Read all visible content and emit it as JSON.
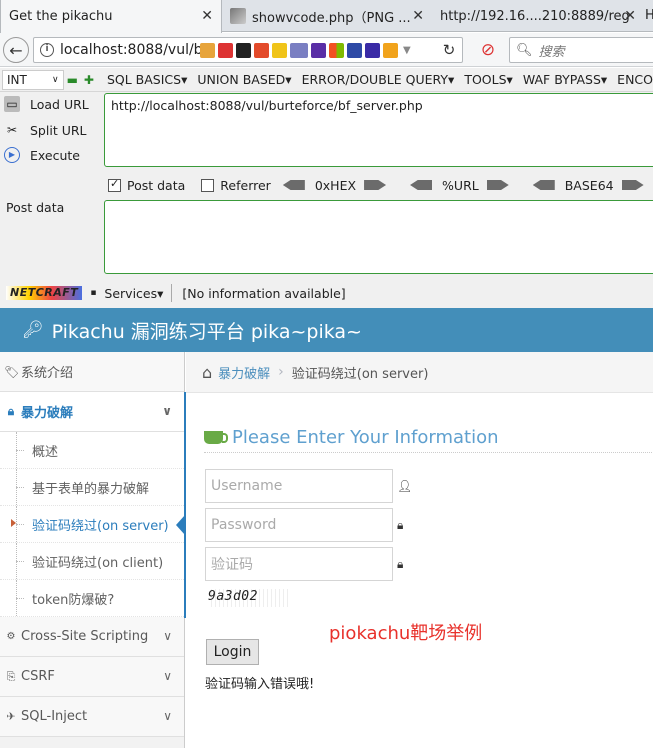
{
  "browser": {
    "tabs": [
      {
        "title": "Get the pikachu",
        "active": true
      },
      {
        "title": "showvcode.php（PNG ...",
        "active": false
      },
      {
        "title": "http://192.16....210:8889/reg",
        "active": false
      }
    ],
    "url": "localhost:8088/vul/b",
    "search_placeholder": "搜索"
  },
  "hackbar": {
    "select_value": "INT",
    "menus": [
      "SQL BASICS▾",
      "UNION BASED▾",
      "ERROR/DOUBLE QUERY▾",
      "TOOLS▾",
      "WAF BYPASS▾",
      "ENCO"
    ],
    "actions": {
      "load_url": "Load URL",
      "split_url": "Split URL",
      "execute": "Execute"
    },
    "url_value": "http://localhost:8088/vul/burteforce/bf_server.php",
    "post_data_checkbox": "Post data",
    "referrer_checkbox": "Referrer",
    "encoders": [
      "0xHEX",
      "%URL",
      "BASE64"
    ],
    "post_data_label": "Post data",
    "netcraft": {
      "logo": "NETCRAFT",
      "services": "Services▾",
      "info": "[No information available]"
    }
  },
  "site": {
    "header_title": "Pikachu 漏洞练习平台 pika~pika~",
    "sidebar": {
      "items": [
        {
          "label": "系统介绍",
          "open": false
        },
        {
          "label": "暴力破解",
          "open": true,
          "children": [
            "概述",
            "基于表单的暴力破解",
            "验证码绕过(on server)",
            "验证码绕过(on client)",
            "token防爆破?"
          ]
        },
        {
          "label": "Cross-Site Scripting",
          "open": false
        },
        {
          "label": "CSRF",
          "open": false
        },
        {
          "label": "SQL-Inject",
          "open": false
        }
      ]
    },
    "breadcrumb": {
      "parent": "暴力破解",
      "current": "验证码绕过(on server)"
    },
    "form": {
      "title": "Please Enter Your Information",
      "username_placeholder": "Username",
      "password_placeholder": "Password",
      "captcha_placeholder": "验证码",
      "captcha_code": "9a3d02",
      "login_label": "Login",
      "error_message": "验证码输入错误哦!"
    },
    "annotation": "piokachu靶场举例"
  },
  "colors": {
    "header_blue": "#438eb9",
    "link_blue": "#4c8fbd",
    "annotation_red": "#e8312b",
    "hackbar_green_border": "#3a9a3a"
  }
}
